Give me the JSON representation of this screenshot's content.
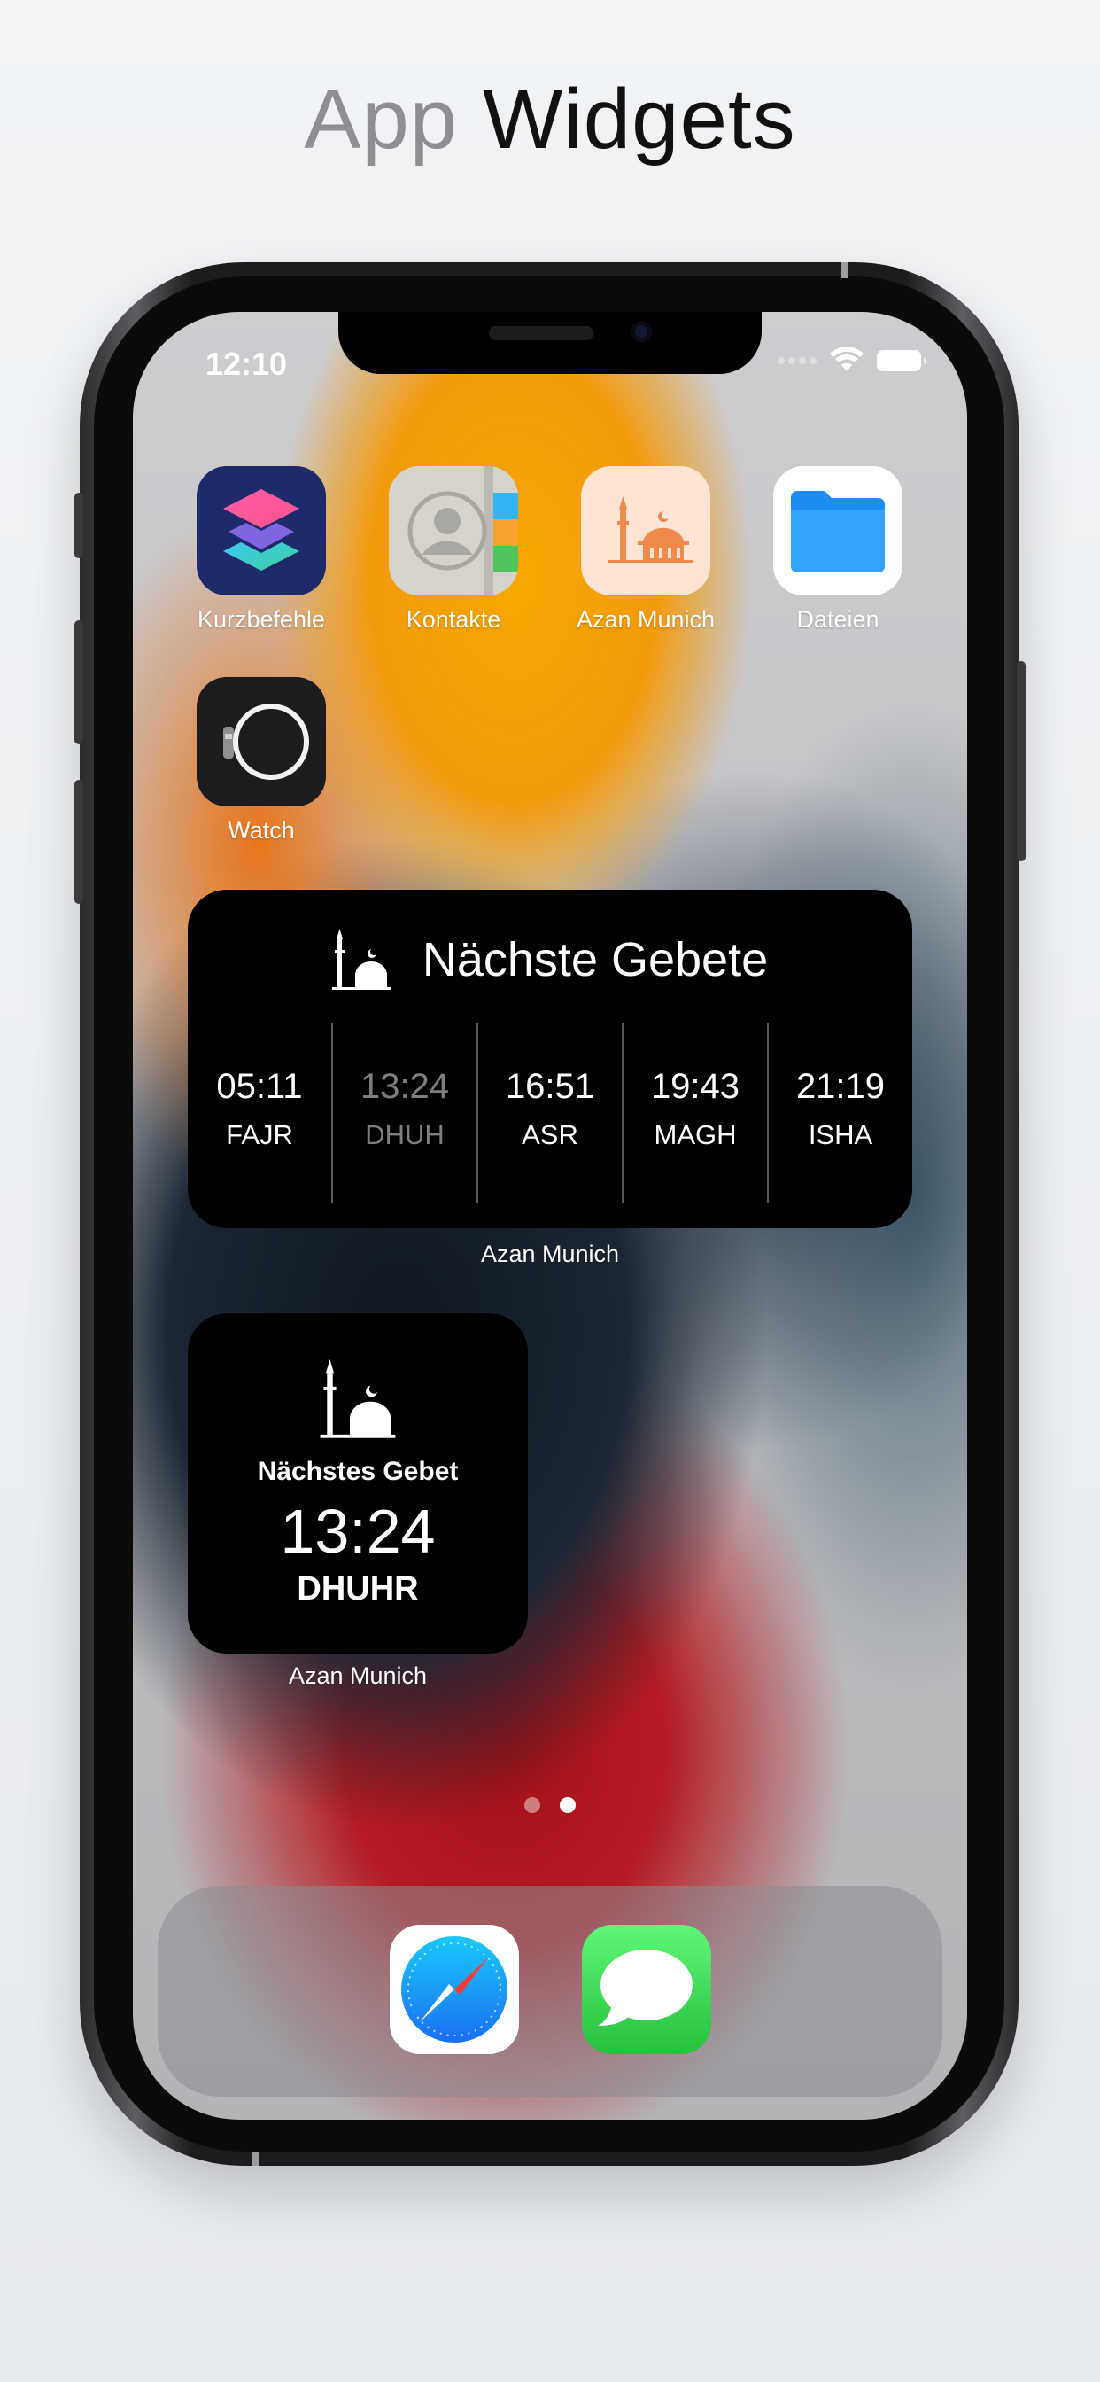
{
  "headline": {
    "light": "App",
    "dark": "Widgets"
  },
  "status_bar": {
    "time": "12:10"
  },
  "apps": [
    {
      "label": "Kurzbefehle",
      "icon": "shortcuts-icon"
    },
    {
      "label": "Kontakte",
      "icon": "contacts-icon"
    },
    {
      "label": "Azan Munich",
      "icon": "mosque-icon"
    },
    {
      "label": "Dateien",
      "icon": "files-folder-icon"
    },
    {
      "label": "Watch",
      "icon": "watch-icon"
    }
  ],
  "widget_medium": {
    "title": "Nächste Gebete",
    "prayers": [
      {
        "time": "05:11",
        "name": "FAJR",
        "dimmed": false
      },
      {
        "time": "13:24",
        "name": "DHUH",
        "dimmed": true
      },
      {
        "time": "16:51",
        "name": "ASR",
        "dimmed": false
      },
      {
        "time": "19:43",
        "name": "MAGH",
        "dimmed": false
      },
      {
        "time": "21:19",
        "name": "ISHA",
        "dimmed": false
      }
    ],
    "app_label": "Azan Munich"
  },
  "widget_small": {
    "subtitle": "Nächstes Gebet",
    "time": "13:24",
    "prayer": "DHUHR",
    "app_label": "Azan Munich"
  },
  "page_indicator": {
    "pages": 2,
    "current": 2
  },
  "dock": [
    {
      "icon": "safari-compass-icon"
    },
    {
      "icon": "messages-bubble-icon"
    }
  ],
  "colors": {
    "shortcuts_bg": "#1f2a6b",
    "contacts_bg": "#d6d3cc",
    "azan_bg": "#fde3d2",
    "azan_accent": "#f08a4b",
    "files_blue": "#1e8cf5",
    "messages_green": "#30d158",
    "widget_bg": "#000000"
  }
}
